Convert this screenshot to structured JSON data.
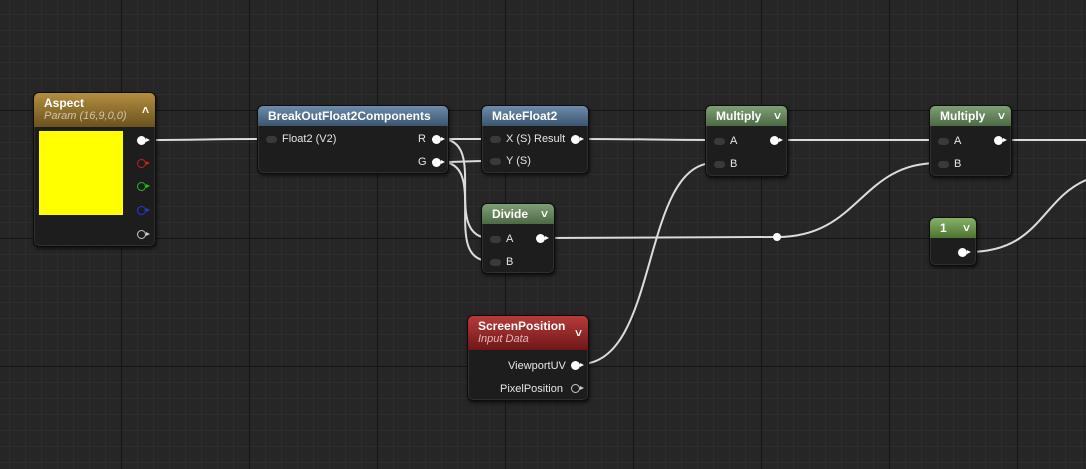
{
  "colors": {
    "swatch": "#ffff00",
    "pin_r": "#cc1f1f",
    "pin_g": "#20c020",
    "pin_b": "#2a36d6",
    "pin_a": "#c8c8c8"
  },
  "nodes": {
    "aspect": {
      "title": "Aspect",
      "subtitle": "Param (16,9,0,0)"
    },
    "breakout": {
      "title": "BreakOutFloat2Components",
      "in_float2": "Float2 (V2)",
      "out_r": "R",
      "out_g": "G"
    },
    "makefloat2": {
      "title": "MakeFloat2",
      "in_x": "X (S)",
      "in_y": "Y (S)",
      "out_result": "Result"
    },
    "divide": {
      "title": "Divide",
      "in_a": "A",
      "in_b": "B"
    },
    "multiply1": {
      "title": "Multiply",
      "in_a": "A",
      "in_b": "B"
    },
    "multiply2": {
      "title": "Multiply",
      "in_a": "A",
      "in_b": "B"
    },
    "constant": {
      "title": "1"
    },
    "screenposition": {
      "title": "ScreenPosition",
      "subtitle": "Input Data",
      "out_viewportuv": "ViewportUV",
      "out_pixelposition": "PixelPosition"
    }
  }
}
